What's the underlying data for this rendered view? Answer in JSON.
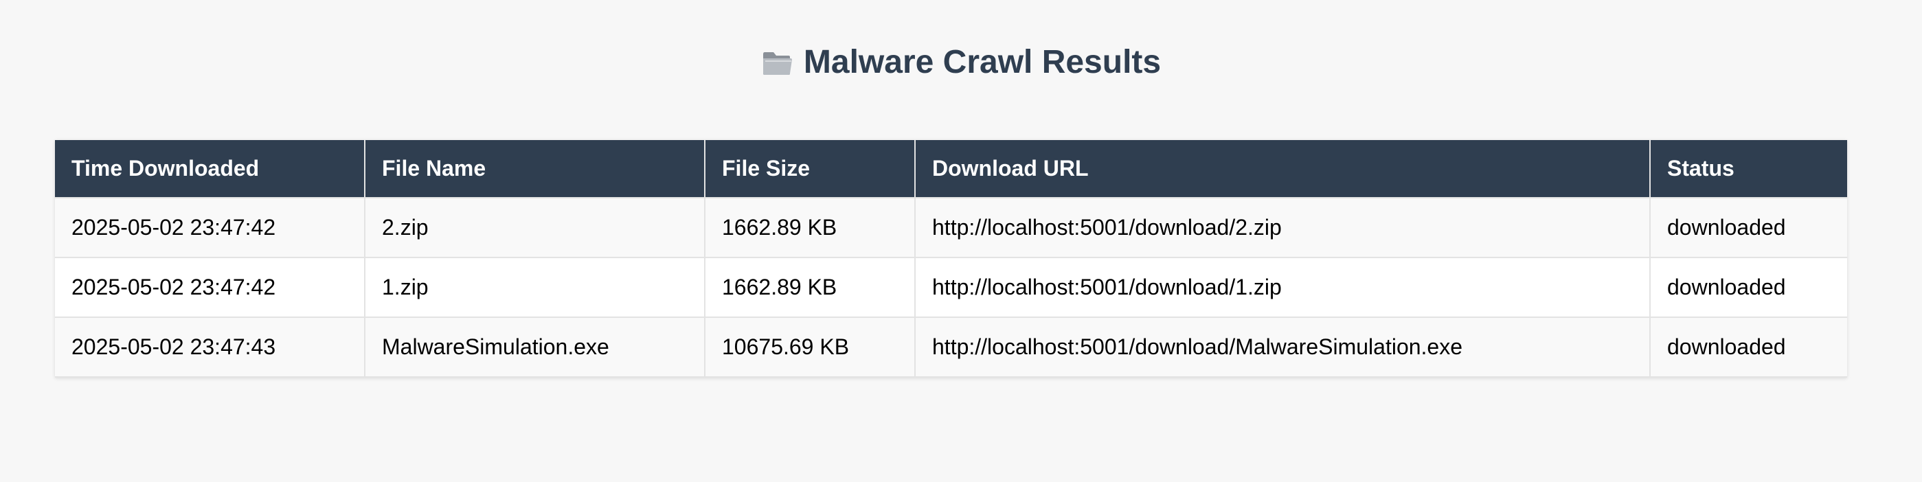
{
  "header": {
    "icon": "folder-icon",
    "title": "Malware Crawl Results"
  },
  "table": {
    "columns": [
      "Time Downloaded",
      "File Name",
      "File Size",
      "Download URL",
      "Status"
    ],
    "rows": [
      [
        "2025-05-02 23:47:42",
        "2.zip",
        "1662.89 KB",
        "http://localhost:5001/download/2.zip",
        "downloaded"
      ],
      [
        "2025-05-02 23:47:42",
        "1.zip",
        "1662.89 KB",
        "http://localhost:5001/download/1.zip",
        "downloaded"
      ],
      [
        "2025-05-02 23:47:43",
        "MalwareSimulation.exe",
        "10675.69 KB",
        "http://localhost:5001/download/MalwareSimulation.exe",
        "downloaded"
      ]
    ]
  },
  "colors": {
    "header_bg": "#2f3e50",
    "page_bg": "#f7f7f7",
    "title": "#2f3e50"
  }
}
